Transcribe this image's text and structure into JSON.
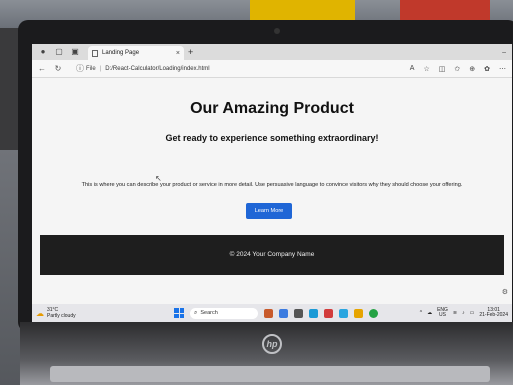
{
  "browser": {
    "tab_title": "Landing Page",
    "tab_close": "×",
    "new_tab": "+",
    "window_controls": "–",
    "address_prefix": "File",
    "address_sep": "|",
    "url": "D:/React-Calculator/Loading/index.html"
  },
  "page": {
    "title": "Our Amazing Product",
    "subtitle": "Get ready to experience something extraordinary!",
    "description": "This is where you can describe your product or service in more detail. Use persuasive language to convince visitors why they should choose your offering.",
    "cta_label": "Learn More",
    "cta_color": "#1f66d6",
    "footer_text": "© 2024 Your Company Name",
    "footer_color": "#1e1e1e"
  },
  "taskbar": {
    "weather_temp": "31°C",
    "weather_desc": "Partly cloudy",
    "search_placeholder": "Search",
    "lang_line1": "ENG",
    "lang_line2": "US",
    "time": "13:01",
    "date": "21-Feb-2024"
  },
  "icons": [
    "back-icon",
    "refresh-icon",
    "info-icon",
    "read-aloud-icon",
    "favorite-icon",
    "split-screen-icon",
    "favorites-icon",
    "collections-icon",
    "copilot-icon",
    "more-icon",
    "gear-icon",
    "search-icon",
    "windows-icon",
    "wifi-icon",
    "volume-icon",
    "battery-icon"
  ]
}
